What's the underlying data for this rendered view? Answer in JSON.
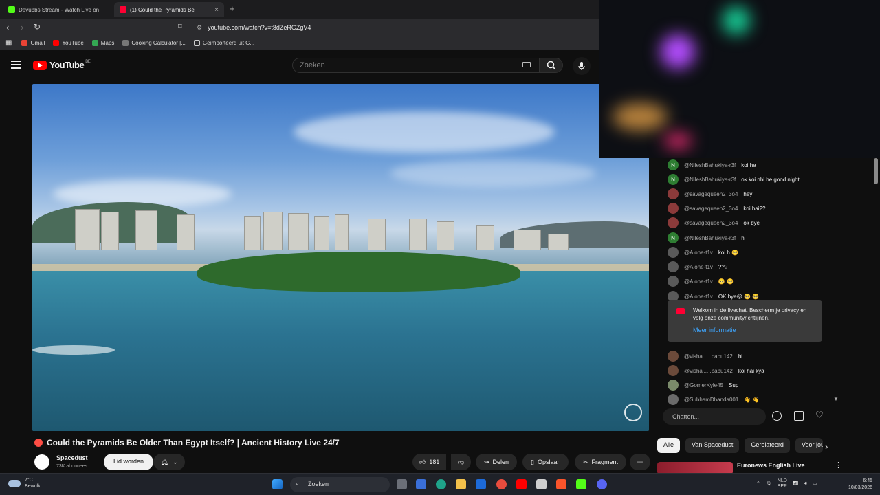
{
  "browser": {
    "tabs": [
      {
        "label": "Devubbs Stream - Watch Live on",
        "color": "#53fc18"
      },
      {
        "label": "(1) Could the Pyramids Be",
        "color": "#ff0033"
      }
    ],
    "new_tab": "+",
    "url": "youtube.com/watch?v=t8dZeRGZgV4",
    "bookmarks": [
      {
        "label": "Gmail",
        "color": "#ea4335"
      },
      {
        "label": "YouTube",
        "color": "#ff0000"
      },
      {
        "label": "Maps",
        "color": "#34a853"
      },
      {
        "label": "Cooking Calculator |...",
        "color": "#777777"
      },
      {
        "label": "Geïmporteerd uit G...",
        "color": "#9aa0a6"
      }
    ]
  },
  "youtube": {
    "logo": "YouTube",
    "region": "BE",
    "search_placeholder": "Zoeken"
  },
  "video": {
    "title": "Could the Pyramids Be Older Than Egypt Itself? | Ancient History Live 24/7",
    "channel": "Spacedust",
    "subscribers": "73K abonnees",
    "join_label": "Lid worden",
    "likes": "181",
    "share_label": "Delen",
    "save_label": "Opslaan",
    "clip_label": "Fragment"
  },
  "chat": {
    "messages": [
      {
        "author": "@NileshBahukiya-r3f",
        "text": "koi he",
        "avatar": "N",
        "color": "#2e7d32"
      },
      {
        "author": "@NileshBahukiya-r3f",
        "text": "ok koi nhi he good night",
        "avatar": "N",
        "color": "#2e7d32"
      },
      {
        "author": "@savagequeen2_3o4",
        "text": "hey",
        "avatar": "",
        "color": "#8b3a3a"
      },
      {
        "author": "@savagequeen2_3o4",
        "text": "koi hai??",
        "avatar": "",
        "color": "#8b3a3a"
      },
      {
        "author": "@savagequeen2_3o4",
        "text": "ok bye",
        "avatar": "",
        "color": "#8b3a3a"
      },
      {
        "author": "@NileshBahukiya-r3f",
        "text": "hi",
        "avatar": "N",
        "color": "#2e7d32"
      },
      {
        "author": "@Alone-t1v",
        "text": "koi h 🥺",
        "avatar": "",
        "color": "#5a5a5a"
      },
      {
        "author": "@Alone-t1v",
        "text": "???",
        "avatar": "",
        "color": "#5a5a5a"
      },
      {
        "author": "@Alone-t1v",
        "text": "🥺 🥺",
        "avatar": "",
        "color": "#5a5a5a"
      },
      {
        "author": "@Alone-t1v",
        "text": "OK bye😖 🥺 🥺",
        "avatar": "",
        "color": "#5a5a5a"
      },
      {
        "author": "@vishal.....babu142",
        "text": "hi",
        "avatar": "",
        "color": "#6b4a3a"
      },
      {
        "author": "@vishal.....babu142",
        "text": "koi hai kya",
        "avatar": "",
        "color": "#6b4a3a"
      },
      {
        "author": "@GomerKyle45",
        "text": "Sup",
        "avatar": "",
        "color": "#7a8a6a"
      },
      {
        "author": "@SubhamDhanda001",
        "text": "👋 👋",
        "avatar": "",
        "color": "#6a6a6a"
      }
    ],
    "welcome_text": "Welkom in de livechat. Bescherm je privacy en volg onze communityrichtlijnen.",
    "welcome_link": "Meer informatie",
    "input_placeholder": "Chatten..."
  },
  "chips": [
    "Alle",
    "Van Spacedust",
    "Gerelateerd",
    "Voor jou"
  ],
  "related": {
    "title": "Euronews English Live"
  },
  "taskbar": {
    "temperature": "7°C",
    "weather": "Bewolkt",
    "search": "Zoeken",
    "lang_top": "NLD",
    "lang_bottom": "BEP",
    "time": "6:45",
    "date": "10/03/2026"
  }
}
